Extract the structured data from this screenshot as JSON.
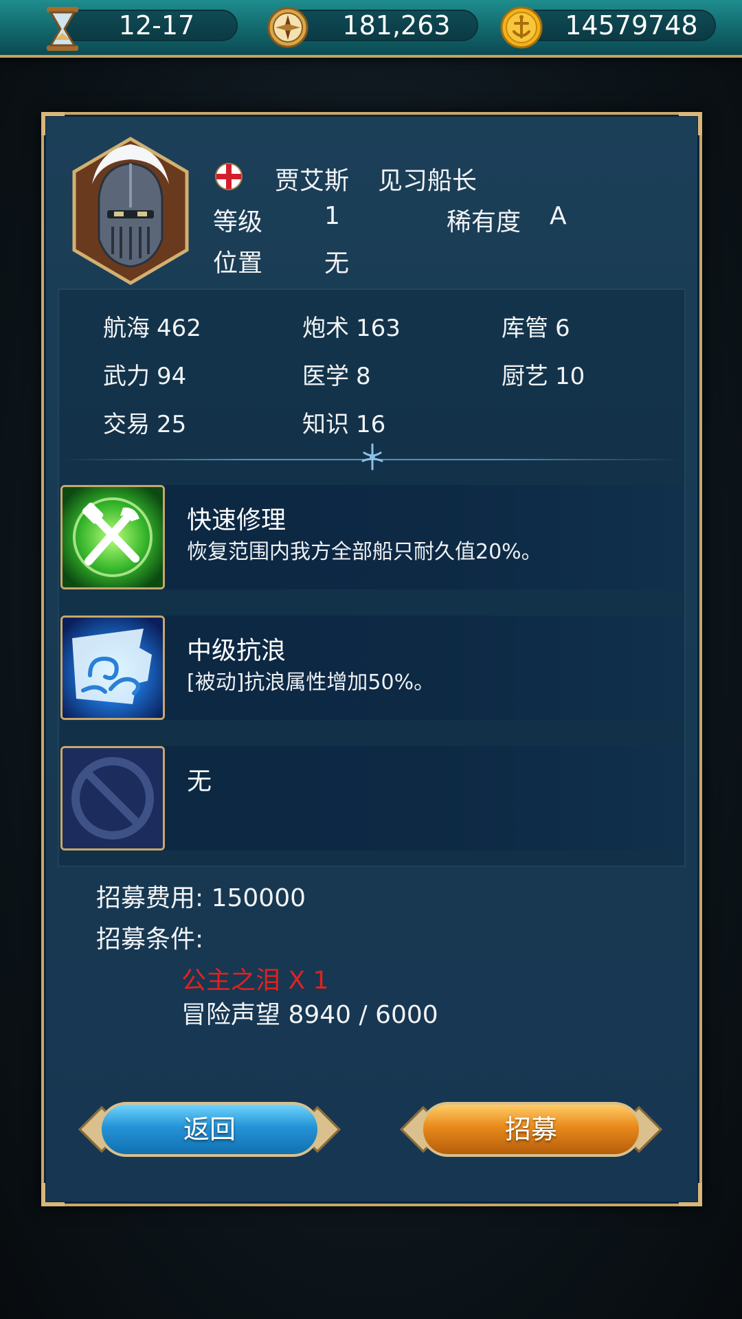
{
  "topbar": {
    "date": "12-17",
    "compass_value": "181,263",
    "gold_value": "14579748"
  },
  "captain": {
    "name": "贾艾斯",
    "title": "见习船长",
    "level_label": "等级",
    "level_value": "1",
    "rarity_label": "稀有度",
    "rarity_value": "A",
    "position_label": "位置",
    "position_value": "无"
  },
  "stats": [
    {
      "label": "航海",
      "value": "462"
    },
    {
      "label": "炮术",
      "value": "163"
    },
    {
      "label": "库管",
      "value": "6"
    },
    {
      "label": "武力",
      "value": "94"
    },
    {
      "label": "医学",
      "value": "8"
    },
    {
      "label": "厨艺",
      "value": "10"
    },
    {
      "label": "交易",
      "value": "25"
    },
    {
      "label": "知识",
      "value": "16"
    }
  ],
  "skills": [
    {
      "name": "快速修理",
      "desc": "恢复范围内我方全部船只耐久值20%。",
      "icon": "repair-tools-icon"
    },
    {
      "name": "中级抗浪",
      "desc": "[被动]抗浪属性增加50%。",
      "icon": "wave-resist-icon"
    },
    {
      "name": "无",
      "desc": "",
      "icon": "none-slot-icon"
    }
  ],
  "recruit": {
    "cost_label": "招募费用: 150000",
    "conditions_label": "招募条件:",
    "item_requirement": "公主之泪 X 1",
    "reputation_requirement": "冒险声望 8940 / 6000"
  },
  "buttons": {
    "back": "返回",
    "recruit": "招募"
  },
  "colors": {
    "panel": "#183a53",
    "gold_border": "#c9a76b",
    "requirement_unmet": "#e0221f"
  }
}
